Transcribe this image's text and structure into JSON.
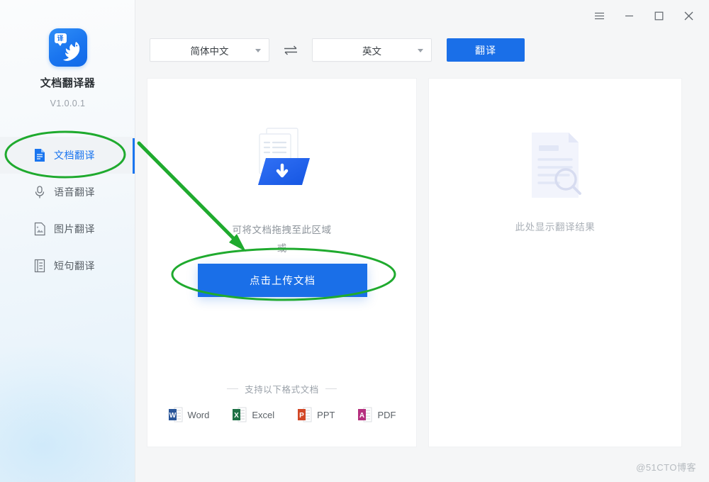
{
  "app": {
    "title": "文档翻译器",
    "version": "V1.0.0.1",
    "logo_badge": "译",
    "watermark": "@51CTO博客"
  },
  "window_controls": [
    {
      "name": "menu-button",
      "icon": "hamburger-menu-icon"
    },
    {
      "name": "minimize-button",
      "icon": "minimize-icon"
    },
    {
      "name": "maximize-button",
      "icon": "maximize-icon"
    },
    {
      "name": "close-button",
      "icon": "close-icon"
    }
  ],
  "sidebar": {
    "items": [
      {
        "label": "文档翻译",
        "icon": "document-icon",
        "active": true
      },
      {
        "label": "语音翻译",
        "icon": "microphone-icon",
        "active": false
      },
      {
        "label": "图片翻译",
        "icon": "image-icon",
        "active": false
      },
      {
        "label": "短句翻译",
        "icon": "list-document-icon",
        "active": false
      }
    ]
  },
  "toolbar": {
    "source_language": "简体中文",
    "target_language": "英文",
    "swap_icon": "swap-arrows-icon",
    "translate_label": "翻译"
  },
  "upload_panel": {
    "drop_hint": "可将文档拖拽至此区域",
    "or_text": "或",
    "upload_button": "点击上传文档",
    "formats_title": "支持以下格式文档",
    "formats": [
      {
        "name": "Word",
        "color": "#2a5699"
      },
      {
        "name": "Excel",
        "color": "#1e7145"
      },
      {
        "name": "PPT",
        "color": "#d24726"
      },
      {
        "name": "PDF",
        "color": "#b5307f"
      }
    ]
  },
  "result_panel": {
    "placeholder": "此处显示翻译结果"
  },
  "annotations": {
    "accent_color": "#1a6fe8",
    "highlight_color": "#1faa2e",
    "ellipse_sidebar_label": "文档翻译-highlight",
    "ellipse_upload_label": "点击上传文档-highlight",
    "arrow_label": "pointer-arrow"
  }
}
